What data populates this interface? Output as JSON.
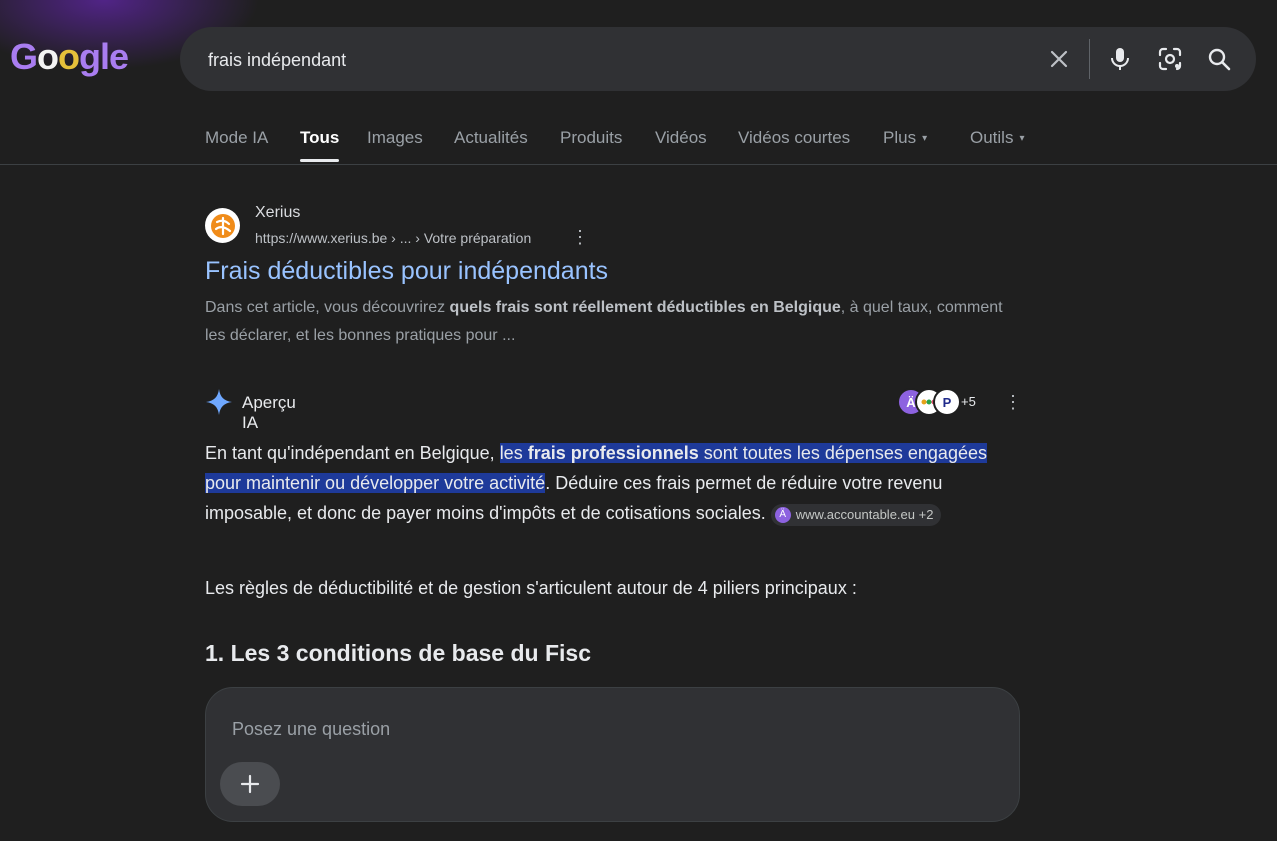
{
  "logo": {
    "text_g": "G",
    "text_o1": "o",
    "text_o2": "o",
    "text_rest": "gle"
  },
  "search": {
    "value": "frais indépendant"
  },
  "icons": {
    "clear": "close-icon",
    "voice": "microphone-icon",
    "lens": "camera-lens-icon",
    "search": "search-icon"
  },
  "tabs": [
    {
      "label": "Mode IA",
      "active": false
    },
    {
      "label": "Tous",
      "active": true
    },
    {
      "label": "Images",
      "active": false
    },
    {
      "label": "Actualités",
      "active": false
    },
    {
      "label": "Produits",
      "active": false
    },
    {
      "label": "Vidéos",
      "active": false
    },
    {
      "label": "Vidéos courtes",
      "active": false
    },
    {
      "label": "Plus",
      "active": false,
      "caret": "▾"
    },
    {
      "label": "Outils",
      "active": false,
      "caret": "▾"
    }
  ],
  "result": {
    "site_name": "Xerius",
    "url": "https://www.xerius.be › ... › Votre préparation",
    "title": "Frais déductibles pour indépendants",
    "snippet_pre": "Dans cet article, vous découvrirez ",
    "snippet_bold": "quels frais sont réellement déductibles en Belgique",
    "snippet_post": ", à quel taux, comment les déclarer, et les bonnes pratiques pour ..."
  },
  "ai_overview": {
    "label": "Aperçu IA",
    "sources_more": "+5",
    "para1_pre": "En tant qu'indépendant en Belgique, ",
    "para1_hl_pre": "les ",
    "para1_hl_bold": "frais professionnels",
    "para1_hl_post": " sont toutes les dépenses engagées pour maintenir ou développer votre activité",
    "para1_post": ". Déduire ces frais permet de réduire votre revenu imposable, et donc de payer moins d'impôts et de cotisations sociales.",
    "chip_label": "www.accountable.eu +2",
    "para2": "Les règles de déductibilité et de gestion s'articulent autour de 4 piliers principaux :",
    "heading": "1. Les 3 conditions de base du Fisc"
  },
  "ask": {
    "placeholder": "Posez une question",
    "plus_label": "+"
  },
  "colors": {
    "background": "#1f1f1f",
    "link": "#99c3ff",
    "highlight": "#1e3a9a",
    "accent_purple": "#8d62e0"
  }
}
